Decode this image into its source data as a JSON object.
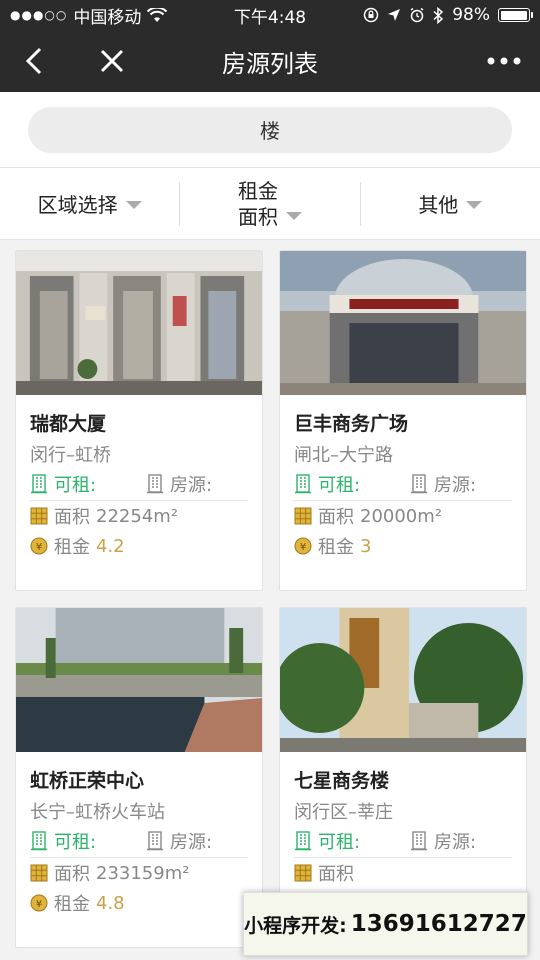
{
  "status": {
    "carrier": "中国移动",
    "time": "下午4:48",
    "battery": "98%",
    "battery_level": 0.98
  },
  "nav": {
    "title": "房源列表"
  },
  "search": {
    "value": "楼"
  },
  "filters": {
    "region": "区域选择",
    "rent": "租金",
    "area": "面积",
    "other": "其他"
  },
  "cards": [
    {
      "name": "瑞都大厦",
      "location": "闵行–虹桥",
      "rent_label": "可租:",
      "listing_label": "房源:",
      "area_label": "面积",
      "area_value": "22254m²",
      "rent_price_label": "租金",
      "rent_price": "4.2"
    },
    {
      "name": "巨丰商务广场",
      "location": "闸北–大宁路",
      "rent_label": "可租:",
      "listing_label": "房源:",
      "area_label": "面积",
      "area_value": "20000m²",
      "rent_price_label": "租金",
      "rent_price": "3"
    },
    {
      "name": "虹桥正荣中心",
      "location": "长宁–虹桥火车站",
      "rent_label": "可租:",
      "listing_label": "房源:",
      "area_label": "面积",
      "area_value": "233159m²",
      "rent_price_label": "租金",
      "rent_price": "4.8"
    },
    {
      "name": "七星商务楼",
      "location": "闵行区–莘庄",
      "rent_label": "可租:",
      "listing_label": "房源:",
      "area_label": "面积",
      "area_value": "",
      "rent_price_label": "",
      "rent_price": ""
    }
  ],
  "promo": {
    "label": "小程序开发:",
    "phone": "13691612727"
  },
  "colors": {
    "nav_bg": "#2b2b2b",
    "rent_green": "#2db36b",
    "price_gold": "#c8a24a"
  }
}
